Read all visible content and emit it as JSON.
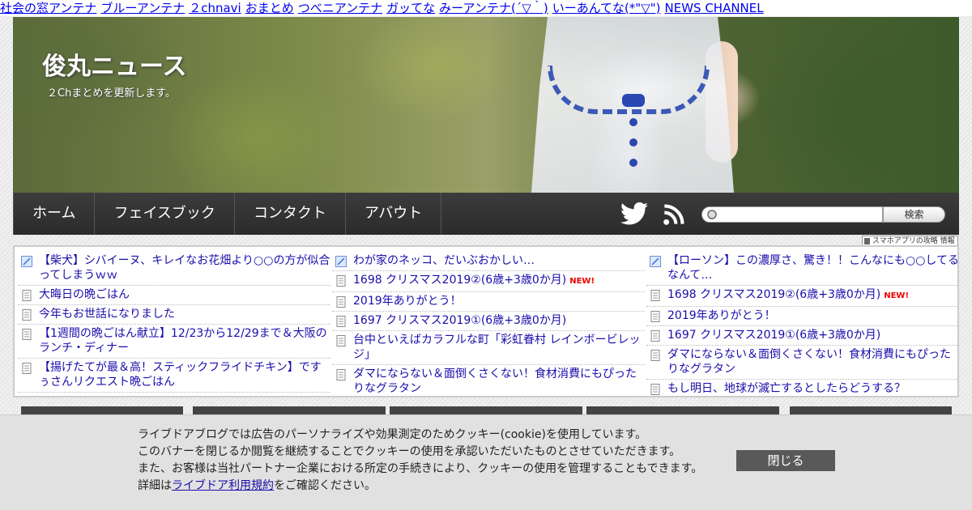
{
  "antenna_links": [
    "社会の窓アンテナ",
    "ブルーアンテナ",
    "２chnavi",
    "おまとめ",
    "つべニアンテナ",
    "ガッてな",
    "みーアンテナ(´▽｀)",
    "いーあんてな(*\"▽\")",
    "NEWS CHANNEL"
  ],
  "header": {
    "title": "俊丸ニュース",
    "description": "２Chまとめを更新します。"
  },
  "nav": {
    "items": [
      "ホーム",
      "フェイスブック",
      "コンタクト",
      "アバウト"
    ],
    "search_button": "検索",
    "search_placeholder": ""
  },
  "app_info_label": "スマホアプリの攻略 情報",
  "feeds": {
    "col1": [
      {
        "icon": "feather-icon",
        "text": "【柴犬】シバイーヌ、キレイなお花畑より○○の方が似合ってしまうｗｗ",
        "new": ""
      },
      {
        "icon": "doc-icon",
        "text": "大晦日の晩ごはん",
        "new": ""
      },
      {
        "icon": "doc-icon",
        "text": "今年もお世話になりました",
        "new": ""
      },
      {
        "icon": "doc-icon",
        "text": "【1週間の晩ごはん献立】12/23から12/29まで＆大阪のランチ・ディナー",
        "new": ""
      },
      {
        "icon": "doc-icon",
        "text": "【揚げたてが最＆高！スティックフライドチキン】ですぅさんリクエスト晩ごはん",
        "new": ""
      }
    ],
    "col2": [
      {
        "icon": "feather-icon",
        "text": "わが家のネッコ、だいぶおかしい…",
        "new": ""
      },
      {
        "icon": "doc-icon",
        "text": "1698 クリスマス2019②(6歳+3歳0か月)",
        "new": "NEW!"
      },
      {
        "icon": "doc-icon",
        "text": "2019年ありがとう！",
        "new": ""
      },
      {
        "icon": "doc-icon",
        "text": "1697 クリスマス2019①(6歳+3歳0か月)",
        "new": ""
      },
      {
        "icon": "doc-icon",
        "text": "台中といえばカラフルな町「彩虹眷村 レインボービレッジ」",
        "new": ""
      },
      {
        "icon": "doc-icon",
        "text": "ダマにならない＆面倒くさくない！食材消費にもぴったりなグラタン",
        "new": ""
      }
    ],
    "col3": [
      {
        "icon": "feather-icon",
        "text": "【ローソン】この濃厚さ、驚き！！こんなにも○○してるなんて…",
        "new": ""
      },
      {
        "icon": "doc-icon",
        "text": "1698 クリスマス2019②(6歳+3歳0か月)",
        "new": "NEW!"
      },
      {
        "icon": "doc-icon",
        "text": "2019年ありがとう！",
        "new": ""
      },
      {
        "icon": "doc-icon",
        "text": "1697 クリスマス2019①(6歳+3歳0か月)",
        "new": ""
      },
      {
        "icon": "doc-icon",
        "text": "ダマにならない＆面倒くさくない！食材消費にもぴったりなグラタン",
        "new": ""
      },
      {
        "icon": "doc-icon",
        "text": "もし明日、地球が滅亡するとしたらどうする？",
        "new": ""
      }
    ]
  },
  "cookie_banner": {
    "line1": "ライブドアブログでは広告のパーソナライズや効果測定のためクッキー(cookie)を使用しています。",
    "line2": "このバナーを閉じるか閲覧を継続することでクッキーの使用を承認いただいたものとさせていただきます。",
    "line3": "また、お客様は当社パートナー企業における所定の手続きにより、クッキーの使用を管理することもできます。",
    "line4_prefix": "詳細は",
    "line4_link": "ライブドア利用規約",
    "line4_suffix": "をご確認ください。",
    "close_label": "閉じる"
  }
}
